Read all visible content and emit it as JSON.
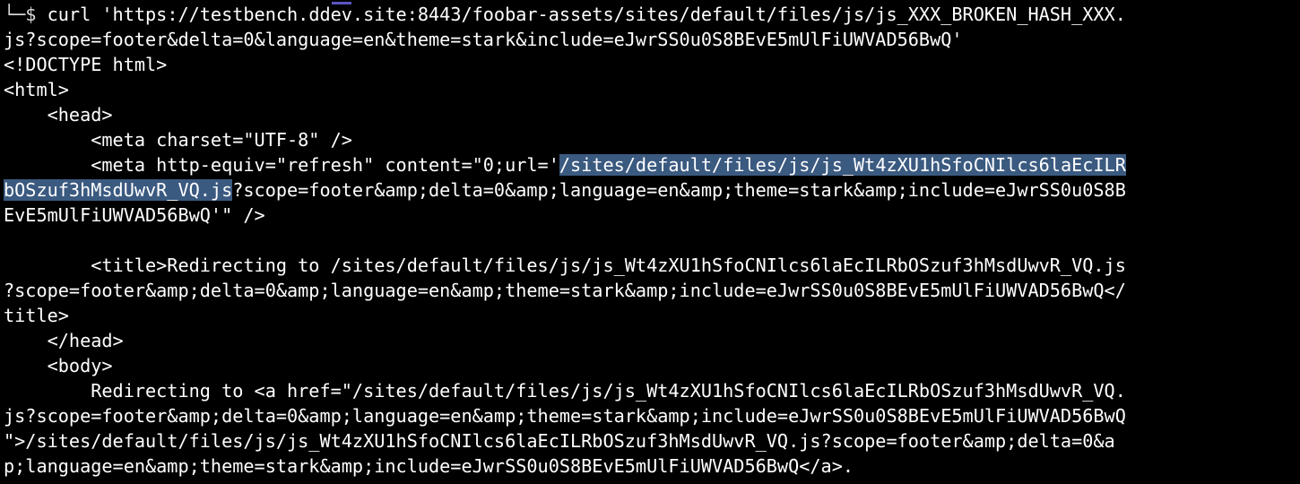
{
  "terminal": {
    "prompt_symbol": "└─$",
    "lines": [
      {
        "type": "prompt",
        "text": " curl 'https://testbench.ddev.site:8443/foobar-assets/sites/default/files/js/js_XXX_BROKEN_HASH_XXX."
      },
      {
        "text": "js?scope=footer&delta=0&language=en&theme=stark&include=eJwrSS0u0S8BEvE5mUlFiUWVAD56BwQ'"
      },
      {
        "text": "<!DOCTYPE html>"
      },
      {
        "text": "<html>"
      },
      {
        "text": "    <head>"
      },
      {
        "text": "        <meta charset=\"UTF-8\" />"
      },
      {
        "pre": "        <meta http-equiv=\"refresh\" content=\"0;url='",
        "sel": "/sites/default/files/js/js_Wt4zXU1hSfoCNIlcs6laEcILR"
      },
      {
        "sel": "bOSzuf3hMsdUwvR_VQ.js",
        "post": "?scope=footer&amp;delta=0&amp;language=en&amp;theme=stark&amp;include=eJwrSS0u0S8B"
      },
      {
        "text": "EvE5mUlFiUWVAD56BwQ'\" />"
      },
      {
        "text": ""
      },
      {
        "text": "        <title>Redirecting to /sites/default/files/js/js_Wt4zXU1hSfoCNIlcs6laEcILRbOSzuf3hMsdUwvR_VQ.js"
      },
      {
        "text": "?scope=footer&amp;delta=0&amp;language=en&amp;theme=stark&amp;include=eJwrSS0u0S8BEvE5mUlFiUWVAD56BwQ</"
      },
      {
        "text": "title>"
      },
      {
        "text": "    </head>"
      },
      {
        "text": "    <body>"
      },
      {
        "text": "        Redirecting to <a href=\"/sites/default/files/js/js_Wt4zXU1hSfoCNIlcs6laEcILRbOSzuf3hMsdUwvR_VQ."
      },
      {
        "text": "js?scope=footer&amp;delta=0&amp;language=en&amp;theme=stark&amp;include=eJwrSS0u0S8BEvE5mUlFiUWVAD56BwQ"
      },
      {
        "text": "\">/sites/default/files/js/js_Wt4zXU1hSfoCNIlcs6laEcILRbOSzuf3hMsdUwvR_VQ.js?scope=footer&amp;delta=0&a"
      },
      {
        "text": "p;language=en&amp;theme=stark&amp;include=eJwrSS0u0S8BEvE5mUlFiUWVAD56BwQ</a>."
      }
    ]
  }
}
